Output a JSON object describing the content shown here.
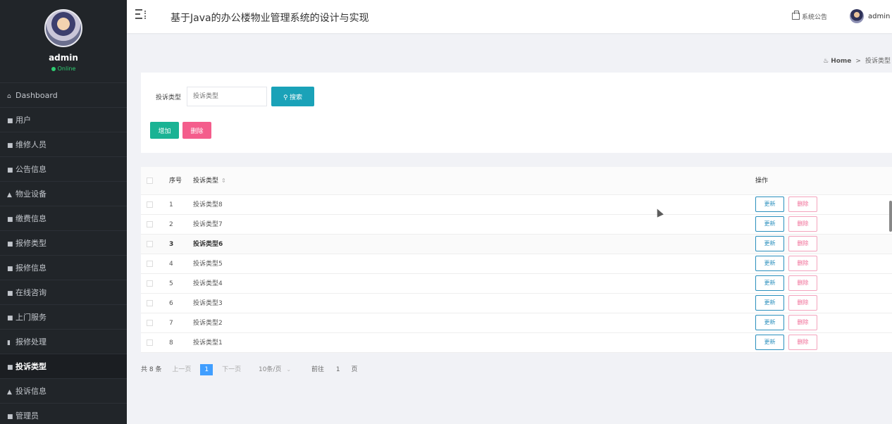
{
  "sidebar": {
    "username": "admin",
    "status": "Online",
    "items": [
      {
        "icon": "⌂",
        "label": "Dashboard"
      },
      {
        "icon": "■",
        "label": "用户"
      },
      {
        "icon": "■",
        "label": "维修人员"
      },
      {
        "icon": "■",
        "label": "公告信息"
      },
      {
        "icon": "▲",
        "label": "物业设备"
      },
      {
        "icon": "■",
        "label": "缴费信息"
      },
      {
        "icon": "■",
        "label": "报修类型"
      },
      {
        "icon": "■",
        "label": "报修信息"
      },
      {
        "icon": "■",
        "label": "在线咨询"
      },
      {
        "icon": "■",
        "label": "上门服务"
      },
      {
        "icon": "▮",
        "label": "报修处理"
      },
      {
        "icon": "■",
        "label": "投诉类型"
      },
      {
        "icon": "▲",
        "label": "投诉信息"
      },
      {
        "icon": "■",
        "label": "管理员"
      }
    ]
  },
  "header": {
    "title": "基于Java的办公楼物业管理系统的设计与实现",
    "notice": "系统公告",
    "user": "admin"
  },
  "breadcrumb": {
    "home": "Home",
    "sep": ">",
    "current": "投诉类型"
  },
  "search": {
    "label": "投诉类型",
    "placeholder": "投诉类型",
    "button": "搜索",
    "add": "增加",
    "delete": "删除"
  },
  "table": {
    "headers": {
      "index": "序号",
      "name": "投诉类型",
      "actions": "操作"
    },
    "update_label": "更新",
    "delete_label": "删除",
    "rows": [
      {
        "index": "1",
        "name": "投诉类型8"
      },
      {
        "index": "2",
        "name": "投诉类型7"
      },
      {
        "index": "3",
        "name": "投诉类型6"
      },
      {
        "index": "4",
        "name": "投诉类型5"
      },
      {
        "index": "5",
        "name": "投诉类型4"
      },
      {
        "index": "6",
        "name": "投诉类型3"
      },
      {
        "index": "7",
        "name": "投诉类型2"
      },
      {
        "index": "8",
        "name": "投诉类型1"
      }
    ]
  },
  "pagination": {
    "total": "共 8 条",
    "prev": "上一页",
    "current": "1",
    "next": "下一页",
    "page_size": "10条/页",
    "goto": "前往",
    "page_value": "1",
    "page_unit": "页"
  },
  "colors": {
    "sidebar_bg": "#212529",
    "search_button": "#1aa2b8",
    "add_button": "#1ab394",
    "delete_button": "#f45d8c",
    "pager_active": "#409eff"
  }
}
